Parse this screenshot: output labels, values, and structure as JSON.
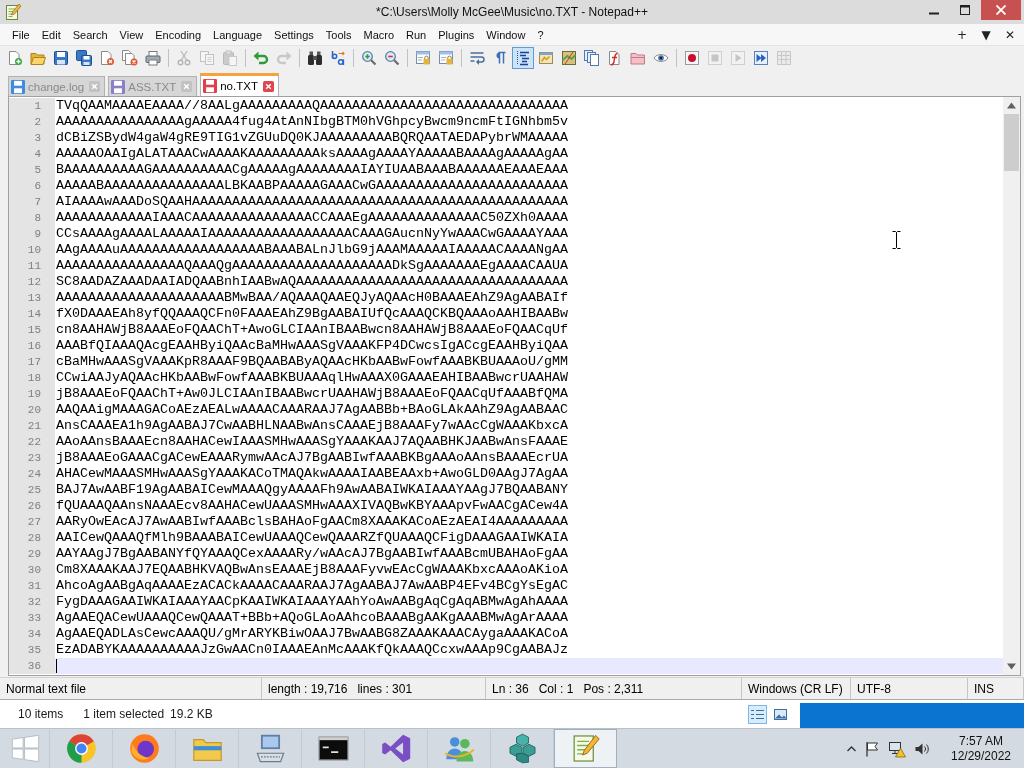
{
  "window": {
    "title": "*C:\\Users\\Molly McGee\\Music\\no.TXT - Notepad++"
  },
  "menu": {
    "items": [
      "File",
      "Edit",
      "Search",
      "View",
      "Encoding",
      "Language",
      "Settings",
      "Tools",
      "Macro",
      "Run",
      "Plugins",
      "Window",
      "?"
    ],
    "controls": [
      "+",
      "▼",
      "✕"
    ]
  },
  "toolbar": [
    [
      {
        "kind": "new",
        "on": false,
        "disabled": false
      },
      {
        "kind": "open",
        "on": false,
        "disabled": false
      },
      {
        "kind": "save",
        "on": false,
        "disabled": false
      },
      {
        "kind": "saveall",
        "on": false,
        "disabled": false
      },
      {
        "kind": "close",
        "on": false,
        "disabled": false
      },
      {
        "kind": "closeall",
        "on": false,
        "disabled": false
      },
      {
        "kind": "print",
        "on": false,
        "disabled": false
      }
    ],
    [
      {
        "kind": "cut",
        "on": false,
        "disabled": true
      },
      {
        "kind": "copy",
        "on": false,
        "disabled": true
      },
      {
        "kind": "paste",
        "on": false,
        "disabled": true
      }
    ],
    [
      {
        "kind": "undo",
        "on": false,
        "disabled": false
      },
      {
        "kind": "redo",
        "on": false,
        "disabled": true
      }
    ],
    [
      {
        "kind": "find",
        "on": false,
        "disabled": false
      },
      {
        "kind": "replace",
        "on": false,
        "disabled": false
      }
    ],
    [
      {
        "kind": "zoomin",
        "on": false,
        "disabled": false
      },
      {
        "kind": "zoomout",
        "on": false,
        "disabled": false
      }
    ],
    [
      {
        "kind": "syncv",
        "on": false,
        "disabled": false
      },
      {
        "kind": "synch",
        "on": false,
        "disabled": false
      }
    ],
    [
      {
        "kind": "wrap",
        "on": false,
        "disabled": false
      },
      {
        "kind": "allchars",
        "on": false,
        "disabled": false
      },
      {
        "kind": "indent",
        "on": true,
        "disabled": false
      },
      {
        "kind": "udl",
        "on": false,
        "disabled": false
      },
      {
        "kind": "map",
        "on": false,
        "disabled": false
      },
      {
        "kind": "doclist",
        "on": false,
        "disabled": false
      },
      {
        "kind": "funclist",
        "on": false,
        "disabled": false
      },
      {
        "kind": "workspace",
        "on": false,
        "disabled": false
      },
      {
        "kind": "monitor",
        "on": false,
        "disabled": false
      }
    ],
    [
      {
        "kind": "record",
        "on": false,
        "disabled": false
      },
      {
        "kind": "stop",
        "on": false,
        "disabled": true
      },
      {
        "kind": "play",
        "on": false,
        "disabled": true
      },
      {
        "kind": "playmulti",
        "on": false,
        "disabled": false
      },
      {
        "kind": "savemacro",
        "on": false,
        "disabled": true
      }
    ]
  ],
  "tabs": [
    {
      "label": "change.log",
      "selected": false,
      "color": "#3d8ce0"
    },
    {
      "label": "ASS.TXT",
      "selected": false,
      "color": "#8b80c8"
    },
    {
      "label": "no.TXT",
      "selected": true,
      "color": "#e0404a"
    }
  ],
  "editor": {
    "lines": [
      {
        "number": "1",
        "text": "TVqQAAMAAAAEAAAA//8AALgAAAAAAAAAQAAAAAAAAAAAAAAAAAAAAAAAAAAAAAAA",
        "current": false
      },
      {
        "number": "2",
        "text": "AAAAAAAAAAAAAAAAgAAAAA4fug4AtAnNIbgBTM0hVGhpcyBwcm9ncmFtIGNhbm5v",
        "current": false
      },
      {
        "number": "3",
        "text": "dCBiZSBydW4gaW4gRE9TIG1vZGUuDQ0KJAAAAAAAAABQRQAATAEDAPybrWMAAAAA",
        "current": false
      },
      {
        "number": "4",
        "text": "AAAAAOAAIgALATAAACwAAAAKAAAAAAAAAksAAAAgAAAAYAAAAABAAAAgAAAAAgAA",
        "current": false
      },
      {
        "number": "5",
        "text": "BAAAAAAAAAAGAAAAAAAAAACgAAAAAgAAAAAAAAIAYIUAABAAABAAAAAAEAAAEAAA",
        "current": false
      },
      {
        "number": "6",
        "text": "AAAAABAAAAAAAAAAAAAAALBKAABPAAAAAGAAACwGAAAAAAAAAAAAAAAAAAAAAAAA",
        "current": false
      },
      {
        "number": "7",
        "text": "AIAAAAwAAADoSQAAHAAAAAAAAAAAAAAAAAAAAAAAAAAAAAAAAAAAAAAAAAAAAAAA",
        "current": false
      },
      {
        "number": "8",
        "text": "AAAAAAAAAAAAIAAACAAAAAAAAAAAAAAACCAAAEgAAAAAAAAAAAAAAC50ZXh0AAAA",
        "current": false
      },
      {
        "number": "9",
        "text": "CCsAAAAgAAAALAAAAAIAAAAAAAAAAAAAAAAAACAAAGAucnNyYwAAACwGAAAAYAAA",
        "current": false
      },
      {
        "number": "10",
        "text": "AAgAAAAuAAAAAAAAAAAAAAAAAABAAABALnJlbG9jAAAMAAAAAIAAAAACAAAANgAA",
        "current": false
      },
      {
        "number": "11",
        "text": "AAAAAAAAAAAAAAAAQAAAQgAAAAAAAAAAAAAAAAAAAADkSgAAAAAAAEgAAAACAAUA",
        "current": false
      },
      {
        "number": "12",
        "text": "SC8AADAZAAADAAIADQAABnhIAABwAQAAAAAAAAAAAAAAAAAAAAAAAAAAAAAAAAAA",
        "current": false
      },
      {
        "number": "13",
        "text": "AAAAAAAAAAAAAAAAAAAAABMwBAA/AQAAAQAAEQJyAQAAcH0BAAAEAhZ9AgAABAIf",
        "current": false
      },
      {
        "number": "14",
        "text": "fX0DAAAEAh8yfQQAAAQCFn0FAAAEAhZ9BgAABAIUfQcAAAQCKBQAAAoAAHIBAABw",
        "current": false
      },
      {
        "number": "15",
        "text": "cn8AAHAWjB8AAAEoFQAAChT+AwoGLCIAAnIBAABwcn8AAHAWjB8AAAEoFQAACqUf",
        "current": false
      },
      {
        "number": "16",
        "text": "AAABfQIAAAQAcgEAAHByiQAAcBaMHwAAASgVAAAKFP4DCwcsIgACcgEAAHByiQAA",
        "current": false
      },
      {
        "number": "17",
        "text": "cBaMHwAAASgVAAAKpR8AAAF9BQAABAByAQAAcHKbAABwFowfAAABKBUAAAoU/gMM",
        "current": false
      },
      {
        "number": "18",
        "text": "CCwiAAJyAQAAcHKbAABwFowfAAABKBUAAAqlHwAAAX0GAAAEAHIBAABwcrUAAHAW",
        "current": false
      },
      {
        "number": "19",
        "text": "jB8AAAEoFQAAChT+Aw0JLCIAAnIBAABwcrUAAHAWjB8AAAEoFQAACqUfAAABfQMA",
        "current": false
      },
      {
        "number": "20",
        "text": "AAQAAigMAAAGACoAEzAEALwAAAACAAARAAJ7AgAABBb+BAoGLAkAAhZ9AgAABAAC",
        "current": false
      },
      {
        "number": "21",
        "text": "AnsCAAAEA1h9AgAABAJ7CwAABHLNAABwAnsCAAAEjB8AAAFy7wAAcCgWAAAKbxcA",
        "current": false
      },
      {
        "number": "22",
        "text": "AAoAAnsBAAAEcn8AAHACewIAAASMHwAAASgYAAAKAAJ7AQAABHKJAABwAnsFAAAE",
        "current": false
      },
      {
        "number": "23",
        "text": "jB8AAAEoGAAACgACewEAAARymwAAcAJ7BgAABIwfAAABKBgAAAoAAnsBAAAEcrUA",
        "current": false
      },
      {
        "number": "24",
        "text": "AHACewMAAASMHwAAASgYAAAKACoTMAQAkwAAAAIAABEAAxb+AwoGLD0AAgJ7AgAA",
        "current": false
      },
      {
        "number": "25",
        "text": "BAJ7AwAABF19AgAABAICewMAAAQgyAAAAFh9AwAABAIWKAIAAAYAAgJ7BQAABANY",
        "current": false
      },
      {
        "number": "26",
        "text": "fQUAAAQAAnsNAAAEcv8AAHACewUAAASMHwAAAXIVAQBwKBYAAApvFwAACgACew4A",
        "current": false
      },
      {
        "number": "27",
        "text": "AARyOwEAcAJ7AwAABIwfAAABclsBAHAoFgAACm8XAAAKACoAEzAEAI4AAAAAAAAA",
        "current": false
      },
      {
        "number": "28",
        "text": "AAICewQAAAQfMlh9BAAABAICewUAAAQCewQAAARZfQUAAAQCFigDAAAGAAIWKAIA",
        "current": false
      },
      {
        "number": "29",
        "text": "AAYAAgJ7BgAABANYfQYAAAQCexAAAARy/wAAcAJ7BgAABIwfAAABcmUBAHAoFgAA",
        "current": false
      },
      {
        "number": "30",
        "text": "Cm8XAAAKAAJ7EQAABHKVAQBwAnsEAAAEjB8AAAFyvwEAcCgWAAAKbxcAAAoAKioA",
        "current": false
      },
      {
        "number": "31",
        "text": "AhcoAgAABgAqAAAAEzACACkAAAACAAARAAJ7AgAABAJ7AwAABP4EFv4BCgYsEgAC",
        "current": false
      },
      {
        "number": "32",
        "text": "FygDAAAGAAIWKAIAAAYAACpKAAIWKAIAAAYAAhYoAwAABgAqCgAqABMwAgAhAAAA",
        "current": false
      },
      {
        "number": "33",
        "text": "AgAAEQACewUAAAQCewQAAAT+BBb+AQoGLAoAAhcoBAAABgAAKgAAABMwAgArAAAA",
        "current": false
      },
      {
        "number": "34",
        "text": "AgAAEQADLAsCewcAAAQU/gMrARYKBiwOAAJ7BwAABG8ZAAAKAAACAygaAAAKACoA",
        "current": false
      },
      {
        "number": "35",
        "text": "EzADABYKAAAAAAAAAAJzGwAACn0IAAAEAnMcAAAKfQkAAAQCcxwAAAp9CgAABAJz",
        "current": false
      },
      {
        "number": "36",
        "current": true
      }
    ]
  },
  "status_bar": {
    "file_type": "Normal text file",
    "length": "length : 19,716",
    "lines": "lines : 301",
    "line": "Ln : 36",
    "column": "Col : 1",
    "position": "Pos : 2,311",
    "eol": "Windows (CR LF)",
    "encoding": "UTF-8",
    "mode": "INS"
  },
  "explorer_status": {
    "count": "10 items",
    "selection": "1 item selected",
    "size": "19.2 KB",
    "views": [
      {
        "kind": "details",
        "selected": true
      },
      {
        "kind": "preview",
        "selected": false
      }
    ]
  },
  "taskbar": {
    "apps": [
      {
        "kind": "start",
        "selected": false
      },
      {
        "kind": "wheel",
        "selected": false
      },
      {
        "kind": "fox",
        "selected": false
      },
      {
        "kind": "folder",
        "selected": false
      },
      {
        "kind": "keyboard",
        "selected": false
      },
      {
        "kind": "terminal",
        "selected": false
      },
      {
        "kind": "ribbon",
        "selected": false
      },
      {
        "kind": "people",
        "selected": false
      },
      {
        "kind": "cubes",
        "selected": false
      },
      {
        "kind": "notepad",
        "selected": true
      }
    ],
    "clock": {
      "time": "7:57 AM",
      "date": "12/29/2022"
    }
  }
}
